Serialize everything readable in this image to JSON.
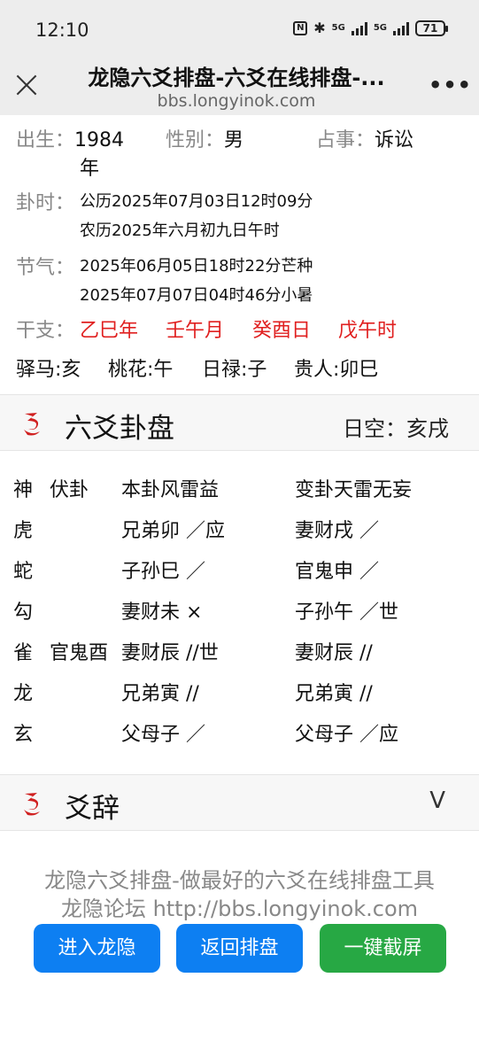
{
  "status": {
    "time": "12:10",
    "net1": "5G",
    "net2": "5G",
    "battery": "71",
    "nfc": "N"
  },
  "header": {
    "title": "龙隐六爻排盘-六爻在线排盘-...",
    "url": "bbs.longyinok.com"
  },
  "info": {
    "birth_label": "出生：",
    "birth_value_1": "1984",
    "birth_value_2": "年",
    "gender_label": "性别：",
    "gender_value": "男",
    "matter_label": "占事：",
    "matter_value": "诉讼",
    "time_label": "卦时：",
    "time_solar": "公历2025年07月03日12时09分",
    "time_lunar": "农历2025年六月初九日午时",
    "solar_term_label": "节气：",
    "solar_term_1": "2025年06月05日18时22分芒种",
    "solar_term_2": "2025年07月07日04时46分小暑",
    "ganzhi_label": "干支：",
    "ganzhi": [
      "乙巳年",
      "壬午月",
      "癸酉日",
      "戊午时"
    ],
    "stars": [
      "驿马:亥",
      "桃花:午",
      "日禄:子",
      "贵人:卯巳"
    ]
  },
  "pan_section": {
    "title": "六爻卦盘",
    "kongwang": "日空：亥戌"
  },
  "gua_table": {
    "header": {
      "shen": "神",
      "fu": "伏卦",
      "ben": "本卦风雷益",
      "bian": "变卦天雷无妄"
    },
    "rows": [
      {
        "shen": "虎",
        "fu": "",
        "ben": "兄弟卯 ／应",
        "bian": "妻财戌 ／"
      },
      {
        "shen": "蛇",
        "fu": "",
        "ben": "子孙巳 ／",
        "bian": "官鬼申 ／"
      },
      {
        "shen": "勾",
        "fu": "",
        "ben": "妻财未 ×",
        "bian": "子孙午 ／世"
      },
      {
        "shen": "雀",
        "fu": "官鬼酉",
        "ben": "妻财辰 //世",
        "bian": "妻财辰 //"
      },
      {
        "shen": "龙",
        "fu": "",
        "ben": "兄弟寅 //",
        "bian": "兄弟寅 //"
      },
      {
        "shen": "玄",
        "fu": "",
        "ben": "父母子 ／",
        "bian": "父母子 ／应"
      }
    ]
  },
  "yaoci_section": {
    "title": "爻辞",
    "toggle": "V"
  },
  "footer": {
    "line1": "龙隐六爻排盘-做最好的六爻在线排盘工具",
    "line2": "龙隐论坛 http://bbs.longyinok.com",
    "buttons": [
      "进入龙隐",
      "返回排盘",
      "一键截屏"
    ]
  },
  "colors": {
    "accent_red": "#e02020",
    "button_blue": "#0d7ff2",
    "button_green": "#27a844"
  }
}
